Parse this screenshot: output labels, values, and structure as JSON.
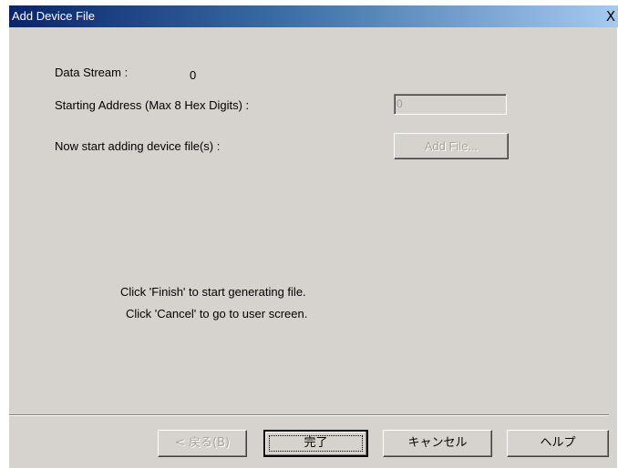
{
  "window": {
    "title": "Add Device File",
    "close_glyph": "X"
  },
  "form": {
    "data_stream_label": "Data Stream :",
    "data_stream_value": "0",
    "starting_address_label": "Starting Address (Max 8 Hex Digits) :",
    "starting_address_value": "0",
    "add_files_label": "Now start adding device file(s) :",
    "add_file_button": "Add File..."
  },
  "instructions": {
    "line1": "Click 'Finish' to start generating file.",
    "line2": "Click 'Cancel' to go to user screen."
  },
  "footer": {
    "back_button": "< 戻る(B)",
    "finish_button": "完了",
    "cancel_button": "キャンセル",
    "help_button": "ヘルプ"
  }
}
